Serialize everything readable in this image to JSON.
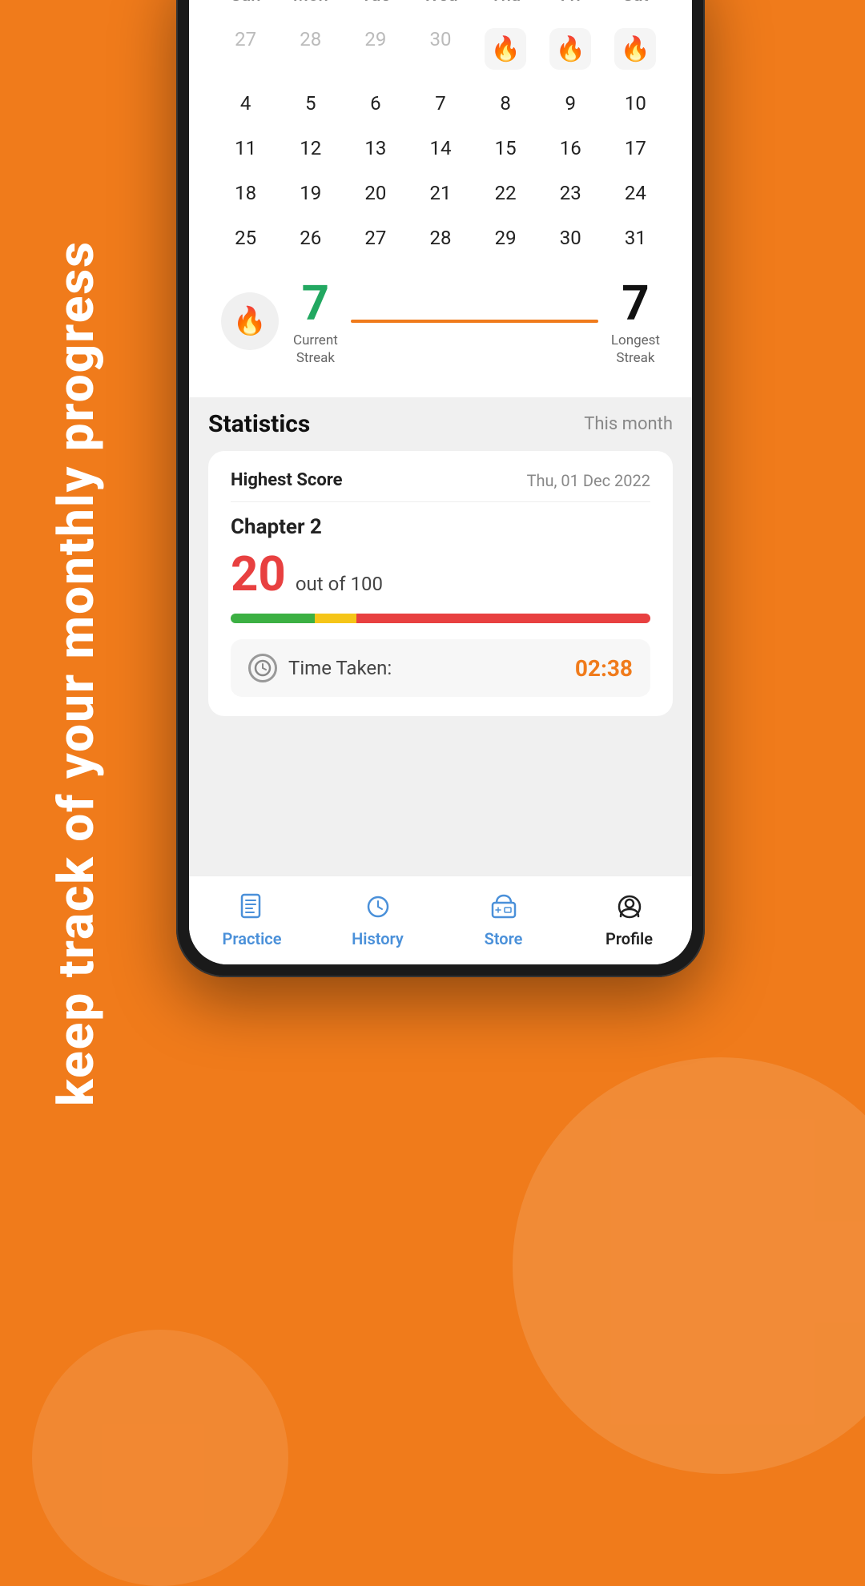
{
  "background": {
    "color": "#F07B1B"
  },
  "sideText": "keep track of your monthly progress",
  "calendar": {
    "dayHeaders": [
      "Sun",
      "Mon",
      "Tue",
      "Wed",
      "Thu",
      "Fri",
      "Sat"
    ],
    "rows": [
      [
        {
          "day": "27",
          "muted": true,
          "fire": false
        },
        {
          "day": "28",
          "muted": true,
          "fire": false
        },
        {
          "day": "29",
          "muted": true,
          "fire": false
        },
        {
          "day": "30",
          "muted": true,
          "fire": false
        },
        {
          "day": "",
          "muted": false,
          "fire": true
        },
        {
          "day": "",
          "muted": false,
          "fire": true
        },
        {
          "day": "",
          "muted": false,
          "fire": true
        }
      ],
      [
        {
          "day": "4",
          "muted": false,
          "fire": false
        },
        {
          "day": "5",
          "muted": false,
          "fire": false
        },
        {
          "day": "6",
          "muted": false,
          "fire": false
        },
        {
          "day": "7",
          "muted": false,
          "fire": false
        },
        {
          "day": "8",
          "muted": false,
          "fire": false
        },
        {
          "day": "9",
          "muted": false,
          "fire": false
        },
        {
          "day": "10",
          "muted": false,
          "fire": false
        }
      ],
      [
        {
          "day": "11",
          "muted": false,
          "fire": false
        },
        {
          "day": "12",
          "muted": false,
          "fire": false
        },
        {
          "day": "13",
          "muted": false,
          "fire": false
        },
        {
          "day": "14",
          "muted": false,
          "fire": false
        },
        {
          "day": "15",
          "muted": false,
          "fire": false
        },
        {
          "day": "16",
          "muted": false,
          "fire": false
        },
        {
          "day": "17",
          "muted": false,
          "fire": false
        }
      ],
      [
        {
          "day": "18",
          "muted": false,
          "fire": false
        },
        {
          "day": "19",
          "muted": false,
          "fire": false
        },
        {
          "day": "20",
          "muted": false,
          "fire": false
        },
        {
          "day": "21",
          "muted": false,
          "fire": false
        },
        {
          "day": "22",
          "muted": false,
          "fire": false
        },
        {
          "day": "23",
          "muted": false,
          "fire": false
        },
        {
          "day": "24",
          "muted": false,
          "fire": false
        }
      ],
      [
        {
          "day": "25",
          "muted": false,
          "fire": false
        },
        {
          "day": "26",
          "muted": false,
          "fire": false
        },
        {
          "day": "27",
          "muted": false,
          "fire": false
        },
        {
          "day": "28",
          "muted": false,
          "fire": false
        },
        {
          "day": "29",
          "muted": false,
          "fire": false
        },
        {
          "day": "30",
          "muted": false,
          "fire": false
        },
        {
          "day": "31",
          "muted": false,
          "fire": false
        }
      ]
    ]
  },
  "streak": {
    "currentValue": "7",
    "currentLabel": "Current\nStreak",
    "longestValue": "7",
    "longestLabel": "Longest\nStreak"
  },
  "statistics": {
    "title": "Statistics",
    "period": "This month",
    "card": {
      "highestScoreLabel": "Highest Score",
      "date": "Thu, 01 Dec 2022",
      "chapter": "Chapter 2",
      "score": "20",
      "outOf": "out of 100",
      "progressGreenWidth": "20%",
      "progressYellowWidth": "10%",
      "timeTakenLabel": "Time Taken:",
      "timeValue": "02:38"
    }
  },
  "bottomNav": {
    "items": [
      {
        "id": "practice",
        "label": "Practice",
        "active": false
      },
      {
        "id": "history",
        "label": "History",
        "active": false
      },
      {
        "id": "store",
        "label": "Store",
        "active": false
      },
      {
        "id": "profile",
        "label": "Profile",
        "active": true
      }
    ]
  }
}
